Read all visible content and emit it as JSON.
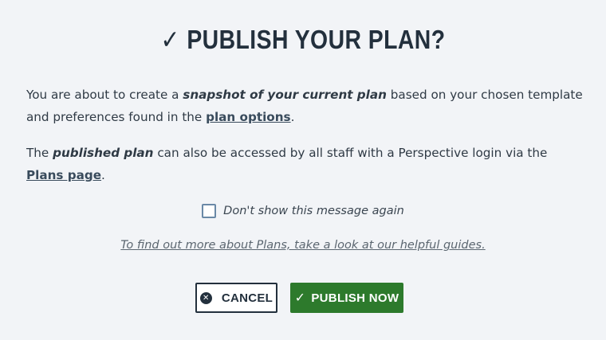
{
  "dialog": {
    "title": "PUBLISH YOUR PLAN?",
    "title_icon": "check-icon",
    "para1": {
      "t1": "You are about to create a ",
      "em1": "snapshot of your current plan",
      "t2": " based on your chosen template and preferences found in the ",
      "link": "plan options",
      "t3": "."
    },
    "para2": {
      "t1": "The ",
      "em1": "published plan",
      "t2": " can also be accessed by all staff with a Perspective login via the ",
      "link": "Plans page",
      "t3": "."
    },
    "dont_show_label": "Don't show this message again",
    "dont_show_checked": false,
    "guide_link": "To find out more about Plans, take a look at our helpful guides.",
    "cancel_label": "CANCEL",
    "publish_label": "PUBLISH NOW"
  },
  "colors": {
    "background": "#f2f4f7",
    "title": "#23303d",
    "publish_button": "#2d7a2c",
    "checkbox_border": "#6a89a7"
  }
}
